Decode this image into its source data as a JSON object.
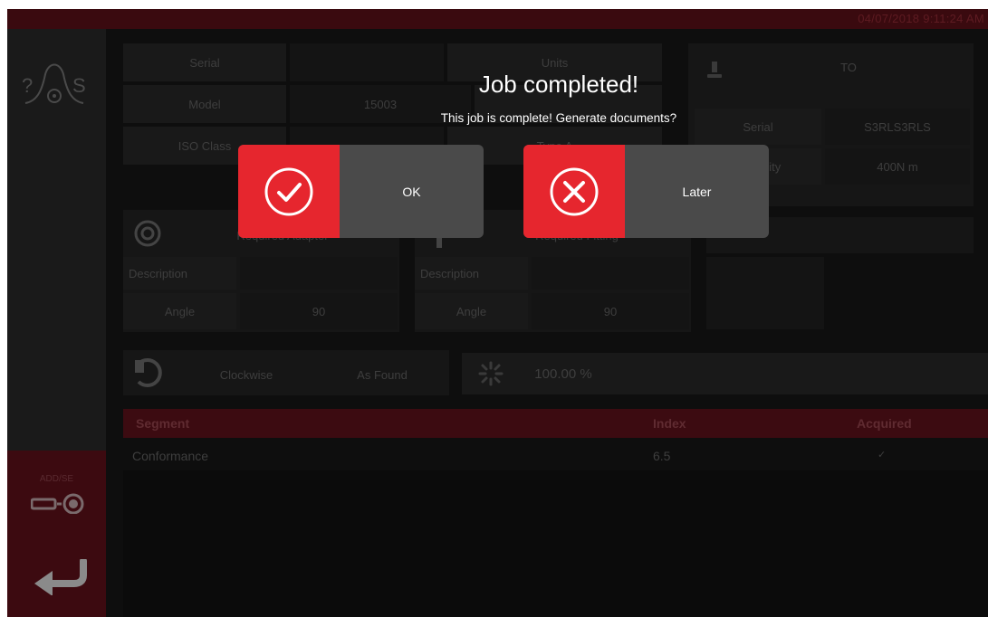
{
  "header": {
    "datetime": "04/07/2018 9:11:24 AM"
  },
  "sidebar": {
    "device_label": "ADD/SE"
  },
  "info": {
    "serial_label": "Serial",
    "model_label": "Model",
    "model_value": "15003",
    "iso_label": "ISO Class",
    "col3_label": "Units",
    "iso_value": "Type A",
    "tool_title": "TO",
    "tool_serial_label": "Serial",
    "tool_serial_value": "S3RLS3RLS",
    "tool_capacity_label": "Capacity",
    "tool_capacity_value": "400N m"
  },
  "adapter": {
    "title": "Required Adapter",
    "desc_label": "Description",
    "angle_label": "Angle",
    "angle_value": "90"
  },
  "fitting": {
    "title": "Required Fitting",
    "desc_label": "Description",
    "angle_label": "Angle",
    "angle_value": "90"
  },
  "direction": {
    "value": "Clockwise",
    "mode": "As Found"
  },
  "progress": {
    "value_text": "100.00 %"
  },
  "table": {
    "columns": [
      "Segment",
      "Index",
      "Acquired"
    ],
    "rows": [
      {
        "segment": "Conformance",
        "index": "6.5",
        "acquired": "✓"
      }
    ]
  },
  "modal": {
    "title": "Job completed!",
    "message": "This job is complete! Generate documents?",
    "ok_label": "OK",
    "later_label": "Later"
  },
  "colors": {
    "accent_red": "#e6262e",
    "button_gray": "#4a4a4a",
    "header_red": "#3c0b11"
  }
}
